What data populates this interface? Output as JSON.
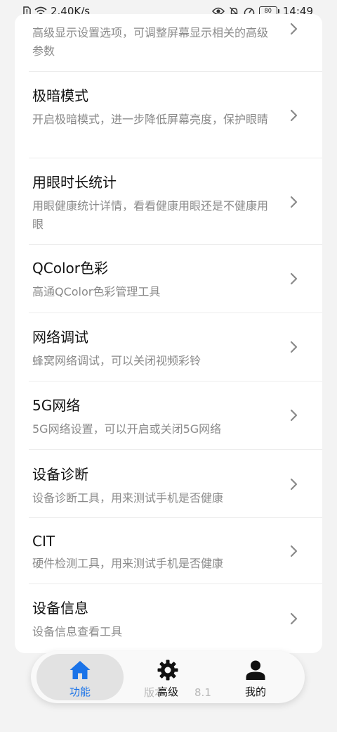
{
  "status_bar": {
    "network_speed": "2.40K/s",
    "battery_level": "80",
    "time": "14:49"
  },
  "settings": [
    {
      "title": "",
      "description": "高级显示设置选项，可调整屏幕显示相关的高级参数"
    },
    {
      "title": "极暗模式",
      "description": "开启极暗模式，进一步降低屏幕亮度，保护眼睛"
    },
    {
      "title": "用眼时长统计",
      "description": "用眼健康统计详情，看看健康用眼还是不健康用眼"
    },
    {
      "title": "QColor色彩",
      "description": "高通QColor色彩管理工具"
    },
    {
      "title": "网络调试",
      "description": "蜂窝网络调试，可以关闭视频彩铃"
    },
    {
      "title": "5G网络",
      "description": "5G网络设置，可以开启或关闭5G网络"
    },
    {
      "title": "设备诊断",
      "description": "设备诊断工具，用来测试手机是否健康"
    },
    {
      "title": "CIT",
      "description": "硬件检测工具，用来测试手机是否健康"
    },
    {
      "title": "设备信息",
      "description": "设备信息查看工具"
    }
  ],
  "bottom_nav": {
    "items": [
      {
        "label": "功能",
        "icon": "home-icon",
        "active": true
      },
      {
        "label": "高级",
        "icon": "gear-icon",
        "active": false
      },
      {
        "label": "我的",
        "icon": "person-icon",
        "active": false
      }
    ],
    "version_text_left": "版本",
    "version_text_right": "8.1"
  },
  "colors": {
    "accent": "#1a73e8",
    "background": "#f3f3f3",
    "card": "#ffffff",
    "title_text": "#111111",
    "desc_text": "#8a8a8a"
  }
}
